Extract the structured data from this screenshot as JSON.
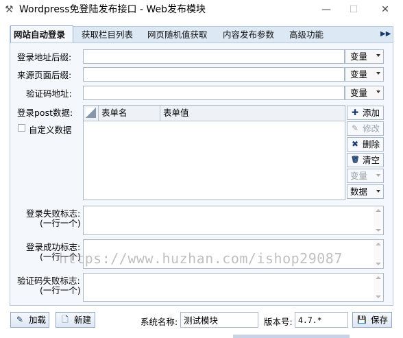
{
  "window": {
    "title": "Wordpress免登陆发布接口 - Web发布模块",
    "app_icon": "tools-icon",
    "minimize": "—",
    "maximize": "☐",
    "close": "✕"
  },
  "tabs": [
    {
      "label": "网站自动登录",
      "active": true
    },
    {
      "label": "获取栏目列表",
      "active": false
    },
    {
      "label": "网页随机值获取",
      "active": false
    },
    {
      "label": "内容发布参数",
      "active": false
    },
    {
      "label": "高级功能",
      "active": false
    }
  ],
  "tab_scroll": "▶▶",
  "login": {
    "login_suffix_label": "登录地址后缀:",
    "login_suffix_value": "",
    "source_suffix_label": "来源页面后缀:",
    "source_suffix_value": "",
    "captcha_label": "验证码地址:",
    "captcha_value": "",
    "variable_combo": "变量",
    "post_label": "登录post数据:",
    "custom_data_label": "自定义数据"
  },
  "grid": {
    "columns": [
      "表单名",
      "表单值"
    ],
    "rows": []
  },
  "side_buttons": {
    "add": {
      "icon": "plus-icon",
      "glyph": "✚",
      "label": "添加"
    },
    "edit": {
      "icon": "pencil-icon",
      "glyph": "✎",
      "label": "修改"
    },
    "delete": {
      "icon": "cross-icon",
      "glyph": "✖",
      "label": "删除"
    },
    "clear": {
      "icon": "trash-icon",
      "glyph": "🗑",
      "label": "清空"
    },
    "variable": {
      "label": "变量"
    },
    "data": {
      "label": "数据"
    }
  },
  "flags": {
    "fail_label": "登录失败标志:",
    "fail_hint": "(一行一个)",
    "success_label": "登录成功标志:",
    "success_hint": "(一行一个)",
    "captcha_fail_label": "验证码失败标志:",
    "captcha_fail_hint": "(一行一个)"
  },
  "watermark": "https://www.huzhan.com/ishop29087",
  "footer": {
    "load_icon": "edit-icon",
    "load_glyph": "✎",
    "load_label": "加载",
    "new_icon": "file-icon",
    "new_glyph": "🗋",
    "new_label": "新建",
    "system_name_label": "系统名称:",
    "system_name_value": "测试模块",
    "version_label": "版本号:",
    "version_value": "4.7.*",
    "save_icon": "save-icon",
    "save_glyph": "💾",
    "save_label": "保存"
  }
}
